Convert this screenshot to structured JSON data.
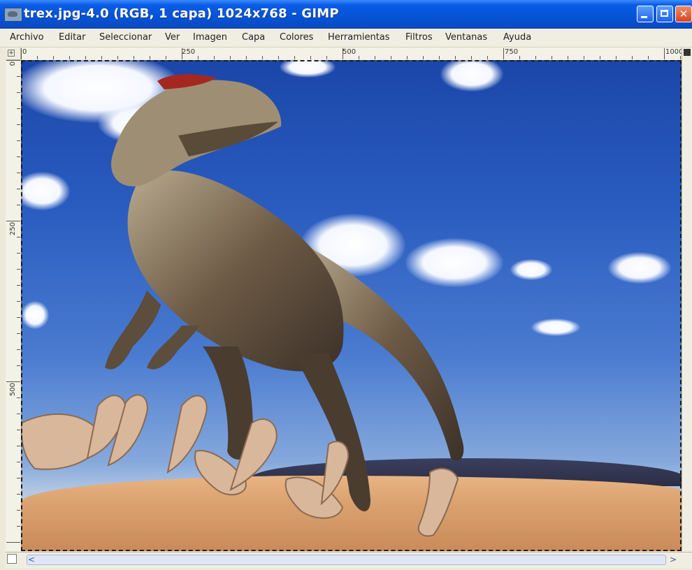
{
  "window": {
    "title": "trex.jpg-4.0 (RGB, 1 capa) 1024x768 - GIMP",
    "icon": "gimp-wilber-icon",
    "controls": {
      "minimize_icon": "minimize-icon",
      "maximize_icon": "maximize-icon",
      "close_glyph": "✕"
    }
  },
  "menubar": {
    "items": [
      {
        "label": "Archivo"
      },
      {
        "label": "Editar"
      },
      {
        "label": "Seleccionar"
      },
      {
        "label": "Ver"
      },
      {
        "label": "Imagen"
      },
      {
        "label": "Capa"
      },
      {
        "label": "Colores"
      },
      {
        "label": "Herramientas"
      },
      {
        "label": "Filtros"
      },
      {
        "label": "Ventanas"
      },
      {
        "label": "Ayuda"
      }
    ]
  },
  "rulers": {
    "top_labels": [
      "0",
      "250",
      "500",
      "750",
      "1000"
    ],
    "left_labels": [
      "0",
      "250",
      "500"
    ],
    "corner_glyph": "+"
  },
  "canvas": {
    "image_description": "",
    "colors": {
      "sky_top": "#1b46a9",
      "sand": "#d9a06d",
      "selection_border": "#1c1c1c"
    }
  },
  "scroll": {
    "left_arrow": "<",
    "right_arrow": ">"
  }
}
